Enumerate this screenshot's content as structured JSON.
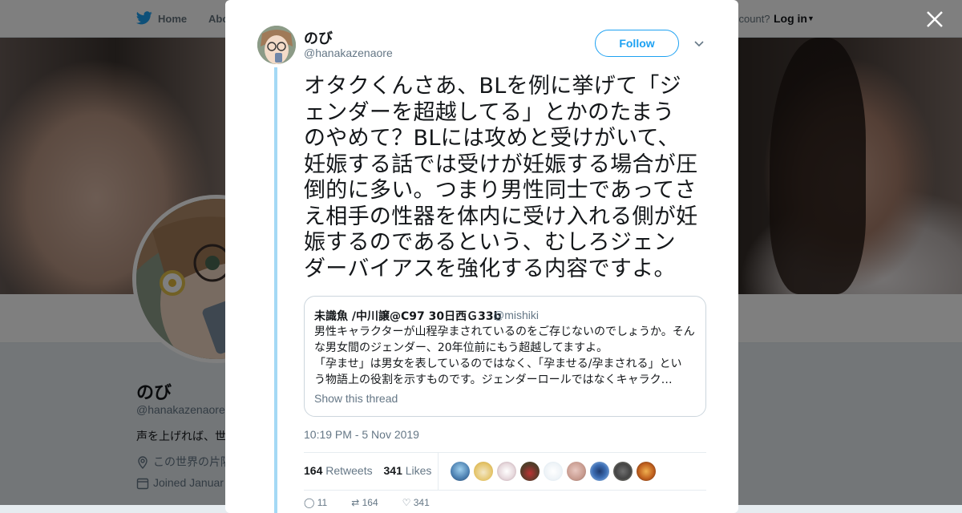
{
  "topnav": {
    "home_label": "Home",
    "about_label": "Abo",
    "account_label": "ccount?",
    "login_label": "Log in"
  },
  "profile": {
    "name": "のび",
    "handle": "@hanakazenaore",
    "bio": "声を上げれば、世",
    "location": "この世界の片隅",
    "joined": "Joined Januar"
  },
  "tweet": {
    "author_name": "のび",
    "author_handle": "@hanakazenaore",
    "follow_label": "Follow",
    "text_lines": [
      "オタクくんさあ、BLを例に挙げて「ジ",
      "ェンダーを超越してる」とかのたまう",
      "のやめて？BLには攻めと受けがいて、",
      "妊娠する話では受けが妊娠する場合が圧",
      "倒的に多い。つまり男性同士であってさ",
      "え相手の性器を体内に受け入れる側が妊",
      "娠するのであるという、むしろジェン",
      "ダーバイアスを強化する内容ですよ。"
    ],
    "timestamp": "10:19 PM - 5 Nov 2019",
    "retweets_count": "164",
    "retweets_label": "Retweets",
    "likes_count": "341",
    "likes_label": "Likes"
  },
  "quote": {
    "name": "未識魚 /中川譲@C97 30日西Ｇ33b",
    "handle": "@mishiki",
    "lines": [
      "男性キャラクターが山程孕まされているのをご存じないのでしょうか。そん",
      "な男女間のジェンダー、20年位前にもう超越してますよ。",
      "「孕ませ」は男女を表しているのではなく、「孕ませる/孕まされる」とい",
      "う物語上の役割を示すものです。ジェンダーロールではなくキャラク…"
    ],
    "show_thread": "Show this thread"
  },
  "actions": {
    "reply_count": "11",
    "retweet_count": "164",
    "like_count": "341"
  },
  "colors": {
    "accent": "#1da1f2",
    "thread_line": "#a4d9f5",
    "muted_text": "#657786"
  },
  "likers_icons": [
    "liker-avatar-1",
    "liker-avatar-2",
    "liker-avatar-3",
    "liker-avatar-4",
    "liker-avatar-5",
    "liker-avatar-6",
    "liker-avatar-7",
    "liker-avatar-8",
    "liker-avatar-9"
  ]
}
